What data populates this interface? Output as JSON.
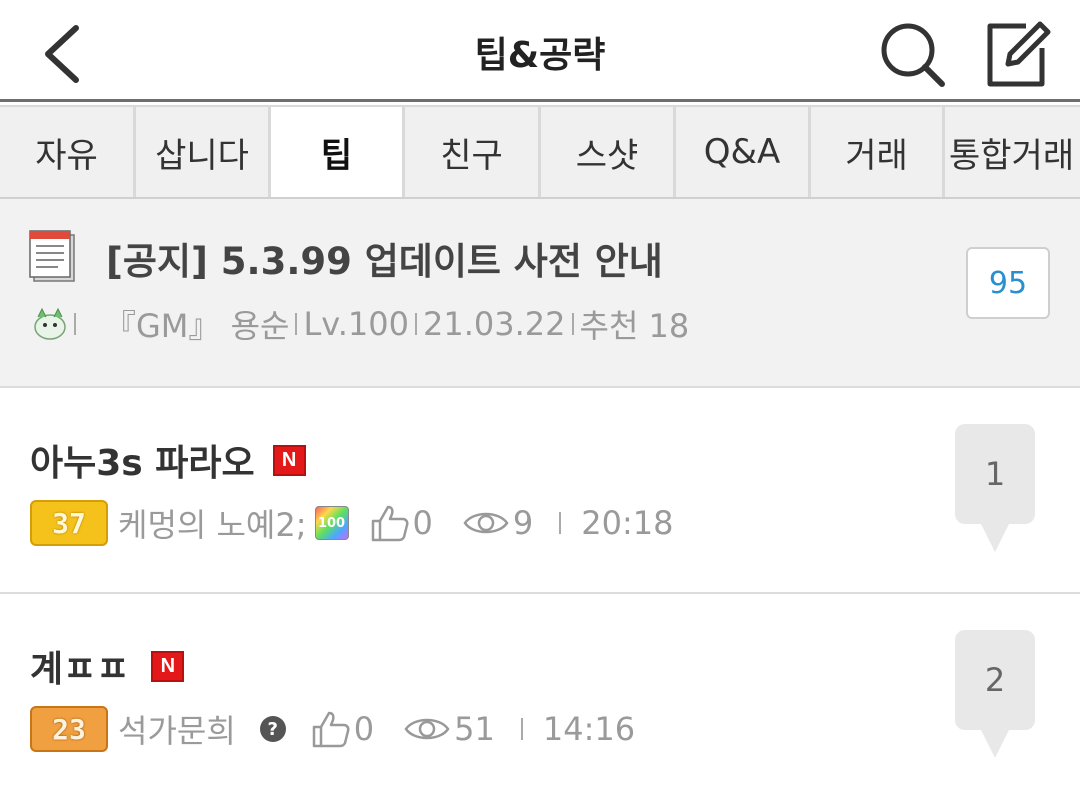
{
  "header": {
    "title": "팁&공략",
    "back_icon": "chevron-left-icon",
    "search_icon": "search-icon",
    "write_icon": "edit-icon"
  },
  "tabs": [
    {
      "label": "자유",
      "active": false
    },
    {
      "label": "삽니다",
      "active": false
    },
    {
      "label": "팁",
      "active": true
    },
    {
      "label": "친구",
      "active": false
    },
    {
      "label": "스샷",
      "active": false
    },
    {
      "label": "Q&A",
      "active": false
    },
    {
      "label": "거래",
      "active": false
    },
    {
      "label": "통합거래",
      "active": false
    }
  ],
  "notice": {
    "title": "[공지] 5.3.99 업데이트 사전 안내",
    "author": "『GM』 용순",
    "level": "Lv.100",
    "date": "21.03.22",
    "recommend": "추천 18",
    "comment_count": "95"
  },
  "posts": [
    {
      "title": "아누3s 파라오",
      "new_badge": "N",
      "level": "37",
      "author": "케멍의 노예2;",
      "badge": "100",
      "likes": "0",
      "views": "9",
      "time": "20:18",
      "comments": "1"
    },
    {
      "title": "계ㅍㅍ",
      "new_badge": "N",
      "level": "23",
      "author": "석가문희",
      "badge": "?",
      "likes": "0",
      "views": "51",
      "time": "14:16",
      "comments": "2"
    }
  ],
  "colors": {
    "accent_blue": "#2a8fd0",
    "new_red": "#e31818",
    "level_gold": "#f5c21b",
    "level_orange": "#f0a040"
  }
}
